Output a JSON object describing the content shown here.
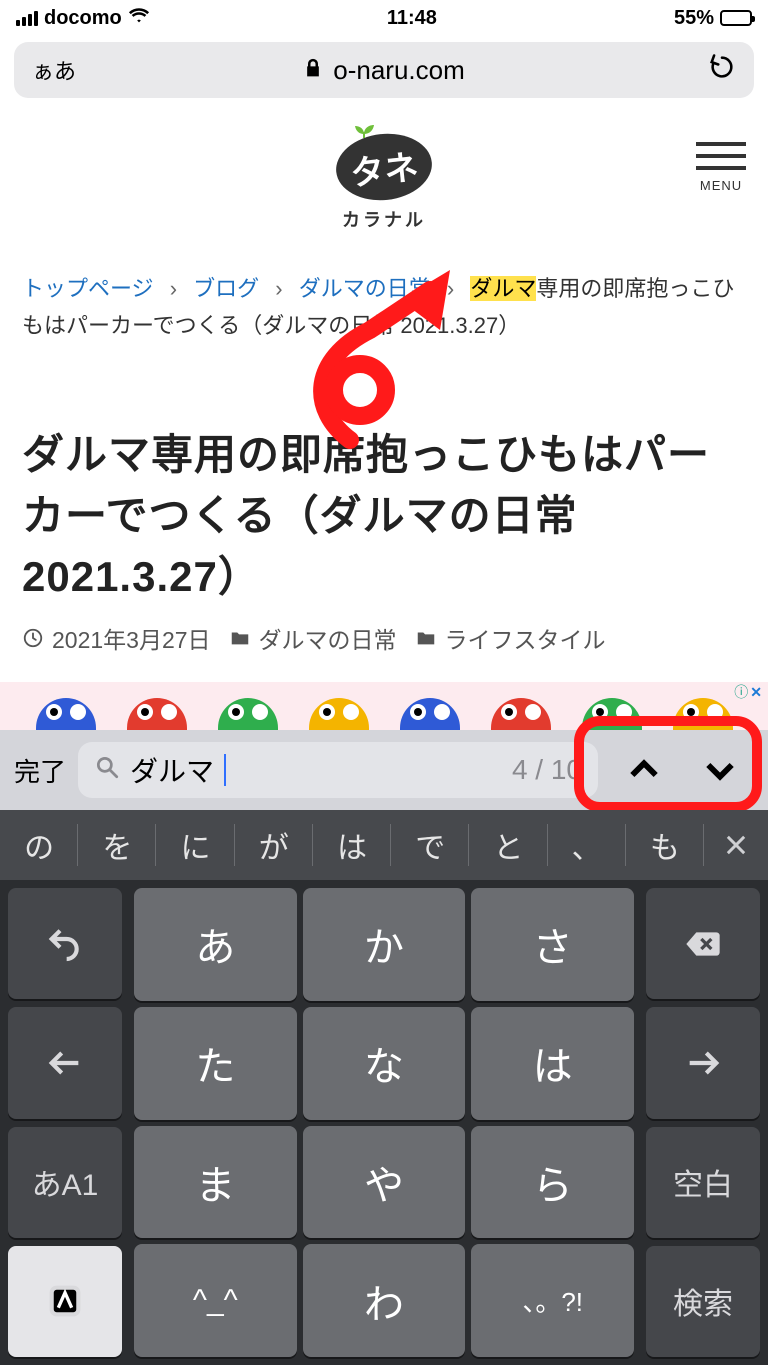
{
  "status": {
    "carrier": "docomo",
    "time": "11:48",
    "battery_pct": "55%",
    "battery_fill_pct": 55
  },
  "urlbar": {
    "left": "ぁあ",
    "domain": "o-naru.com"
  },
  "site": {
    "logo_main": "タネ",
    "logo_sub": "カラナル",
    "menu_label": "MENU"
  },
  "breadcrumb": {
    "items": [
      "トップページ",
      "ブログ",
      "ダルマの日常"
    ],
    "highlight": "ダルマ",
    "tail": "専用の即席抱っこひもはパーカーでつくる（ダルマの日常 2021.3.27）",
    "sep": "›"
  },
  "article": {
    "title": "ダルマ専用の即席抱っこひもはパーカーでつくる（ダルマの日常2021.3.27）",
    "date": "2021年3月27日",
    "cat1": "ダルマの日常",
    "cat2": "ライフスタイル"
  },
  "ad": {
    "info": "ⓘ",
    "close": "✕"
  },
  "find": {
    "done": "完了",
    "query": "ダルマ",
    "count": "4 / 10"
  },
  "keyboard": {
    "suggestions": [
      "の",
      "を",
      "に",
      "が",
      "は",
      "で",
      "と",
      "、",
      "も"
    ],
    "grid": [
      "あ",
      "か",
      "さ",
      "た",
      "な",
      "は",
      "ま",
      "や",
      "ら",
      "^_^",
      "わ",
      "、。?!"
    ],
    "mode": "あA1",
    "space": "空白",
    "search": "検索"
  }
}
